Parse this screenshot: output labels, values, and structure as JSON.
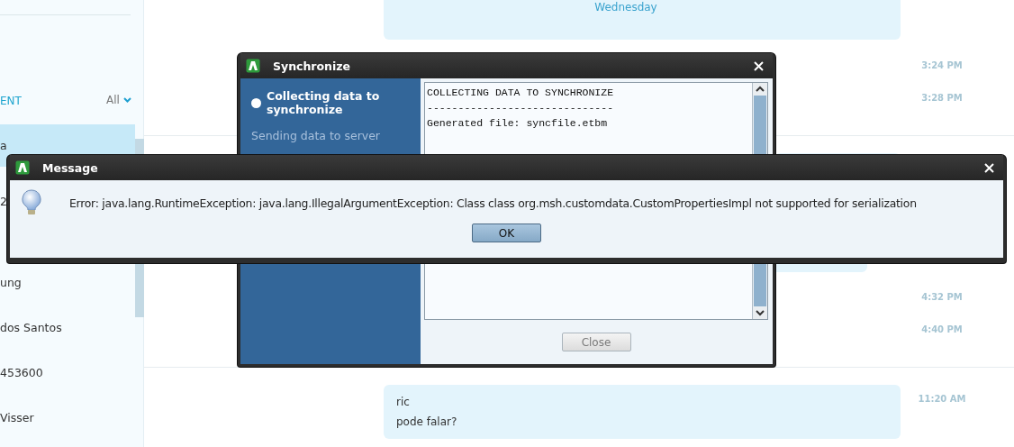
{
  "sidebar": {
    "header": "ENT",
    "filter": "All",
    "items": [
      {
        "name": "a",
        "selected": true
      },
      {
        "name": "2",
        "selected": false
      },
      {
        "name": "ung",
        "selected": false
      },
      {
        "name": "dos Santos",
        "selected": false
      },
      {
        "name": "453600",
        "selected": false
      },
      {
        "name": "Visser",
        "selected": false
      }
    ]
  },
  "chat": {
    "day_label": "Wednesday",
    "messages": [
      {
        "time": "3:24 PM"
      },
      {
        "time": "3:28 PM"
      },
      {
        "time": "4:32 PM"
      },
      {
        "time": "4:40 PM"
      },
      {
        "lines": [
          "ric",
          "pode falar?"
        ],
        "time": "11:20 AM"
      }
    ]
  },
  "sync_window": {
    "title": "Synchronize",
    "steps": [
      {
        "label": "Collecting data to synchronize",
        "active": true
      },
      {
        "label": "Sending data to server",
        "active": false
      }
    ],
    "log": [
      "COLLECTING DATA TO SYNCHRONIZE",
      "------------------------------",
      "Generated file: syncfile.etbm"
    ],
    "close_button": {
      "label": "Close",
      "disabled": true
    }
  },
  "message_dialog": {
    "title": "Message",
    "text": "Error: java.lang.RuntimeException: java.lang.IllegalArgumentException: Class class org.msh.customdata.CustomPropertiesImpl not supported for serialization",
    "ok_button": "OK"
  }
}
